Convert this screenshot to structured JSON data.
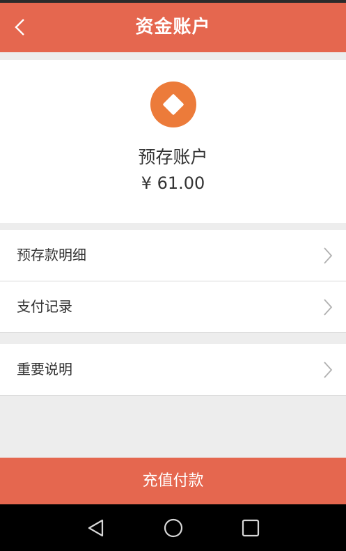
{
  "header": {
    "title": "资金账户",
    "back_icon": "chevron-left-icon"
  },
  "account": {
    "icon": "diamond-coin-icon",
    "icon_color": "#ec7b3a",
    "name": "预存账户",
    "balance": "¥ 61.00"
  },
  "menu": {
    "items": [
      {
        "label": "预存款明细",
        "icon": "chevron-right-icon"
      },
      {
        "label": "支付记录",
        "icon": "chevron-right-icon"
      },
      {
        "label": "重要说明",
        "icon": "chevron-right-icon"
      }
    ]
  },
  "footer": {
    "recharge_label": "充值付款"
  },
  "system_nav": {
    "back": "triangle-back-icon",
    "home": "circle-home-icon",
    "recents": "square-recents-icon"
  },
  "colors": {
    "accent": "#e5674f",
    "background": "#ededed"
  }
}
